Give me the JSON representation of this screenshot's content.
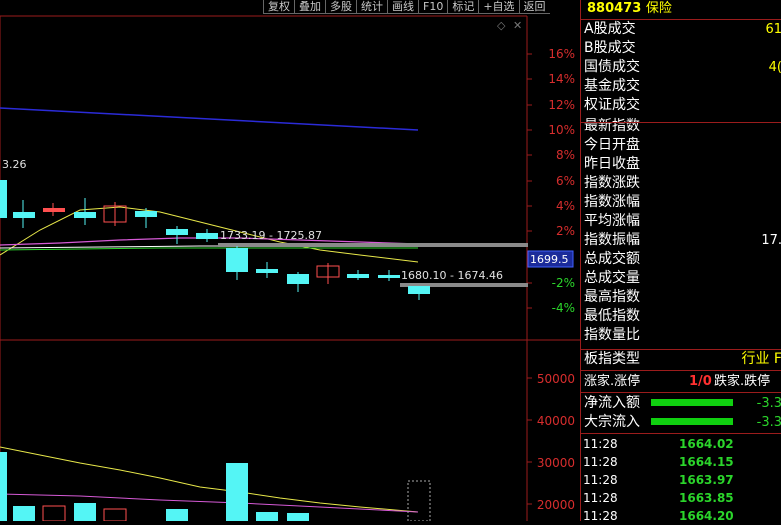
{
  "toolbar": {
    "items": [
      "复权",
      "叠加",
      "多股",
      "统计",
      "画线",
      "F10",
      "标记",
      "+自选",
      "返回"
    ]
  },
  "price_chart": {
    "pct_ticks": [
      "16%",
      "14%",
      "12%",
      "10%",
      "8%",
      "6%",
      "4%",
      "2%",
      "-2%",
      "-4%"
    ],
    "label_left": "3.26",
    "annotation_1": "1733.19 - 1725.87",
    "annotation_2": "1680.10 - 1674.46",
    "current_price_tag": "1699.5"
  },
  "volume_chart": {
    "ticks": [
      "50000",
      "40000",
      "30000",
      "20000"
    ]
  },
  "panel": {
    "header": {
      "code": "880473",
      "name": "保险"
    },
    "rows": [
      {
        "label": "A股成交",
        "value": "61",
        "color": "#ffff00"
      },
      {
        "label": "B股成交",
        "value": "",
        "color": "#ffff00"
      },
      {
        "label": "国债成交",
        "value": "4(",
        "color": "#ffff00"
      },
      {
        "label": "基金成交",
        "value": "",
        "color": "#ffff00"
      },
      {
        "label": "权证成交",
        "value": "",
        "color": "#ffff00"
      },
      {
        "label": "最新指数",
        "value": "",
        "color": "#ffffff"
      },
      {
        "label": "今日开盘",
        "value": "",
        "color": "#ffffff"
      },
      {
        "label": "昨日收盘",
        "value": "",
        "color": "#ffffff"
      },
      {
        "label": "指数涨跌",
        "value": "",
        "color": "#ffffff"
      },
      {
        "label": "指数涨幅",
        "value": "",
        "color": "#ffffff"
      },
      {
        "label": "平均涨幅",
        "value": "",
        "color": "#ffffff"
      },
      {
        "label": "指数振幅",
        "value": "17.",
        "color": "#ffffff"
      },
      {
        "label": "总成交额",
        "value": "",
        "color": "#ffffff"
      },
      {
        "label": "总成交量",
        "value": "",
        "color": "#ffffff"
      },
      {
        "label": "最高指数",
        "value": "",
        "color": "#ffffff"
      },
      {
        "label": "最低指数",
        "value": "",
        "color": "#ffffff"
      },
      {
        "label": "指数量比",
        "value": "",
        "color": "#ffffff"
      }
    ],
    "sector_type": {
      "label": "板指类型",
      "value": "行业 F"
    },
    "up_down": {
      "label_up": "涨家.涨停",
      "ratio": "1/0",
      "label_down": "跌家.跌停"
    },
    "flows": [
      {
        "label": "净流入额",
        "value": "-3.3"
      },
      {
        "label": "大宗流入",
        "value": "-3.3"
      }
    ],
    "ticks": [
      {
        "time": "11:28",
        "price": "1664.02"
      },
      {
        "time": "11:28",
        "price": "1664.15"
      },
      {
        "time": "11:28",
        "price": "1663.97"
      },
      {
        "time": "11:28",
        "price": "1663.85"
      },
      {
        "time": "11:28",
        "price": "1664.20"
      }
    ]
  }
}
